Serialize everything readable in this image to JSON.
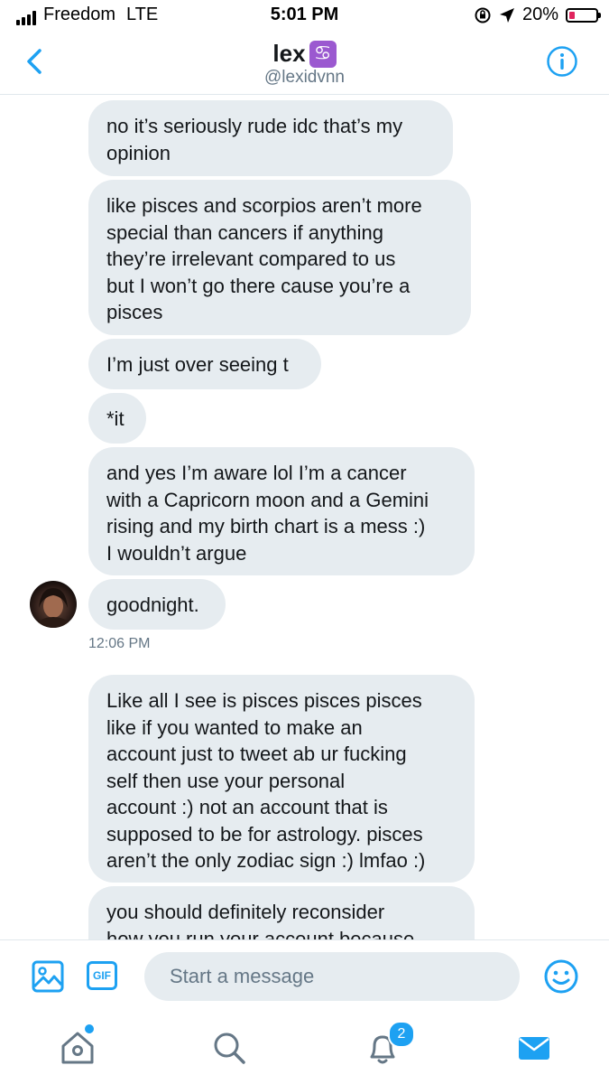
{
  "status_bar": {
    "carrier": "Freedom",
    "network": "LTE",
    "time": "5:01 PM",
    "battery_percent": "20%",
    "battery_level": 0.2,
    "battery_color": "#e0245e"
  },
  "header": {
    "name": "lex",
    "name_emoji": "♋",
    "handle": "@lexidvnn",
    "back_icon": "chevron-left-icon",
    "info_icon": "info-icon"
  },
  "messages": [
    {
      "text": "no it’s seriously rude idc that’s my\nopinion"
    },
    {
      "text": "like pisces and scorpios aren’t more\nspecial than cancers if anything\nthey’re irrelevant compared to us\nbut I won’t go there cause you’re a\npisces"
    },
    {
      "text": "I’m just over seeing t"
    },
    {
      "text": "*it"
    },
    {
      "text": "and yes I’m aware lol I’m a cancer\nwith a Capricorn moon and a Gemini\nrising and my birth chart is a mess :)\nI wouldn’t argue"
    },
    {
      "text": "goodnight."
    },
    {
      "text": "Like all I see is pisces pisces pisces\nlike if you wanted to make an\naccount just to tweet ab ur fucking\nself then use your personal\naccount :) not an account that is\nsupposed to be for astrology. pisces\naren’t the only zodiac sign :) lmfao :)"
    },
    {
      "text": "you should definitely reconsider\nhow you run your account because"
    }
  ],
  "timestamp": "12:06 PM",
  "composer": {
    "placeholder": "Start a message",
    "gif_label": "GIF",
    "media_icon": "image-icon",
    "emoji_icon": "smiley-icon"
  },
  "tab_bar": {
    "items": [
      {
        "name": "home",
        "icon": "home-icon"
      },
      {
        "name": "search",
        "icon": "search-icon"
      },
      {
        "name": "notifications",
        "icon": "bell-icon"
      },
      {
        "name": "messages",
        "icon": "mail-icon"
      }
    ],
    "notifications_count": "2",
    "accent_color": "#1da1f2"
  }
}
